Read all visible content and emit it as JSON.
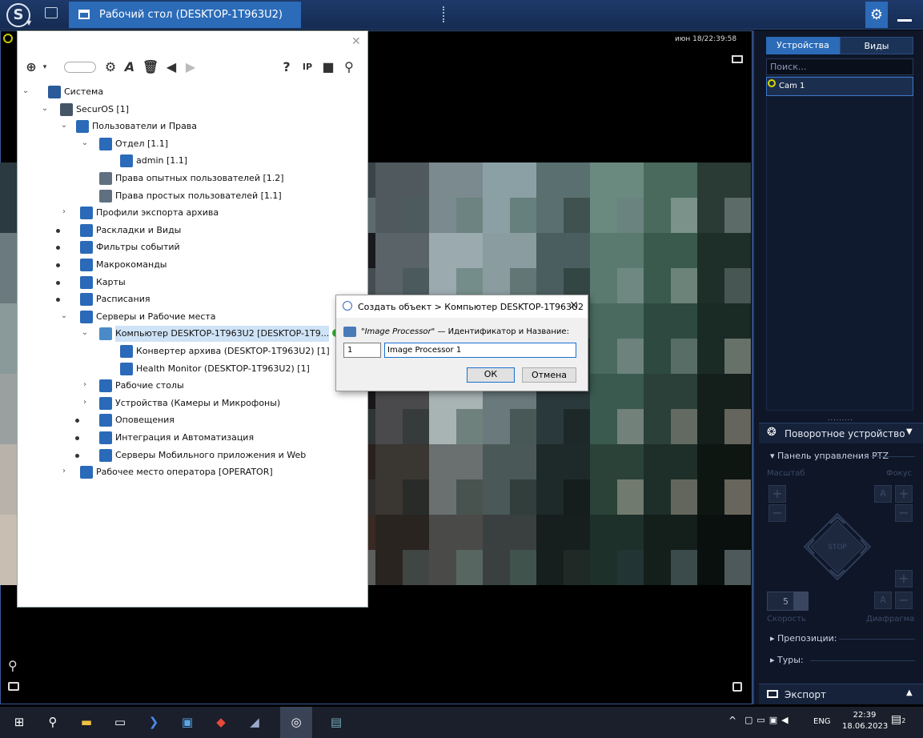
{
  "topbar": {
    "tab_title": "Рабочий стол (DESKTOP-1T963U2)"
  },
  "video": {
    "timestamp": "июн 18/22:39:58"
  },
  "right_panel": {
    "tabs": [
      "Устройства",
      "Виды"
    ],
    "search_placeholder": "Поиск...",
    "camera": "Cam 1",
    "ptz_title": "Поворотное устройство",
    "ptz_panel": "Панель управления PTZ",
    "zoom_label": "Масштаб",
    "focus_label": "Фокус",
    "stop_label": "STOP",
    "speed_value": "5",
    "speed_label": "Скорость",
    "iris_label": "Диафрагма",
    "presets": "Препозиции:",
    "tours": "Туры:",
    "export": "Экспорт"
  },
  "tree": {
    "rows": [
      {
        "label": "Система"
      },
      {
        "label": "SecurOS [1]"
      },
      {
        "label": "Пользователи и Права"
      },
      {
        "label": "Отдел [1.1]"
      },
      {
        "label": "admin [1.1]"
      },
      {
        "label": "Права опытных пользователей [1.2]"
      },
      {
        "label": "Права простых пользователей [1.1]"
      },
      {
        "label": "Профили экспорта архива"
      },
      {
        "label": "Раскладки и Виды"
      },
      {
        "label": "Фильтры событий"
      },
      {
        "label": "Макрокоманды"
      },
      {
        "label": "Карты"
      },
      {
        "label": "Расписания"
      },
      {
        "label": "Серверы и Рабочие места"
      },
      {
        "label": "Компьютер DESKTOP-1T963U2 [DESKTOP-1T9..."
      },
      {
        "label": "Конвертер архива (DESKTOP-1T963U2) [1]"
      },
      {
        "label": "Health Monitor (DESKTOP-1T963U2) [1]"
      },
      {
        "label": "Рабочие столы"
      },
      {
        "label": "Устройства (Камеры и Микрофоны)"
      },
      {
        "label": "Оповещения"
      },
      {
        "label": "Интеграция и Автоматизация"
      },
      {
        "label": "Серверы Мобильного приложения и Web"
      },
      {
        "label": "Рабочее место оператора [OPERATOR]"
      }
    ]
  },
  "dialog": {
    "title": "Создать объект > Компьютер DESKTOP-1T963U2",
    "prompt_type": "\"Image Processor\"",
    "prompt_rest": " — Идентификатор и Название:",
    "id_value": "1",
    "name_value": "Image Processor 1",
    "ok": "ОК",
    "cancel": "Отмена"
  },
  "taskbar": {
    "lang": "ENG",
    "time": "22:39",
    "date": "18.06.2023",
    "notif_count": "2"
  }
}
